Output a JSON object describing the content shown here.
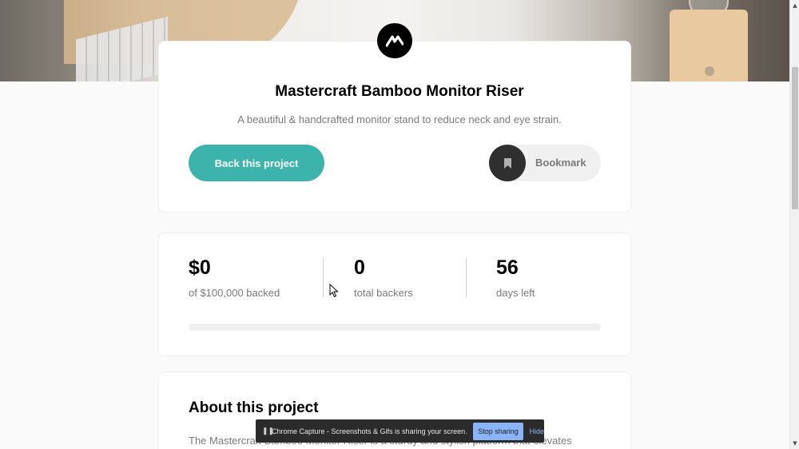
{
  "project": {
    "title": "Mastercraft Bamboo Monitor Riser",
    "description": "A beautiful & handcrafted monitor stand to reduce neck and eye strain.",
    "back_button_label": "Back this project",
    "bookmark_label": "Bookmark",
    "logo_icon": "mastercraft-logo-icon",
    "bookmark_icon": "bookmark-icon"
  },
  "stats": {
    "backed_value": "$0",
    "backed_label": "of $100,000 backed",
    "backers_value": "0",
    "backers_label": "total backers",
    "days_value": "56",
    "days_label": "days left",
    "progress_fraction": 0
  },
  "about": {
    "title": "About this project",
    "body_visible": "The Mastercraft Bamboo Monitor Riser is a sturdy and stylish platform that elevates"
  },
  "capture_bar": {
    "message": "Chrome Capture - Screenshots & Gifs is sharing your screen.",
    "stop_label": "Stop sharing",
    "hide_label": "Hide"
  },
  "colors": {
    "accent": "#3cb4ac",
    "bookmark_dark": "#2f2f2f",
    "text_muted": "#7a7a7a",
    "capture_button": "#8ab4f8"
  }
}
